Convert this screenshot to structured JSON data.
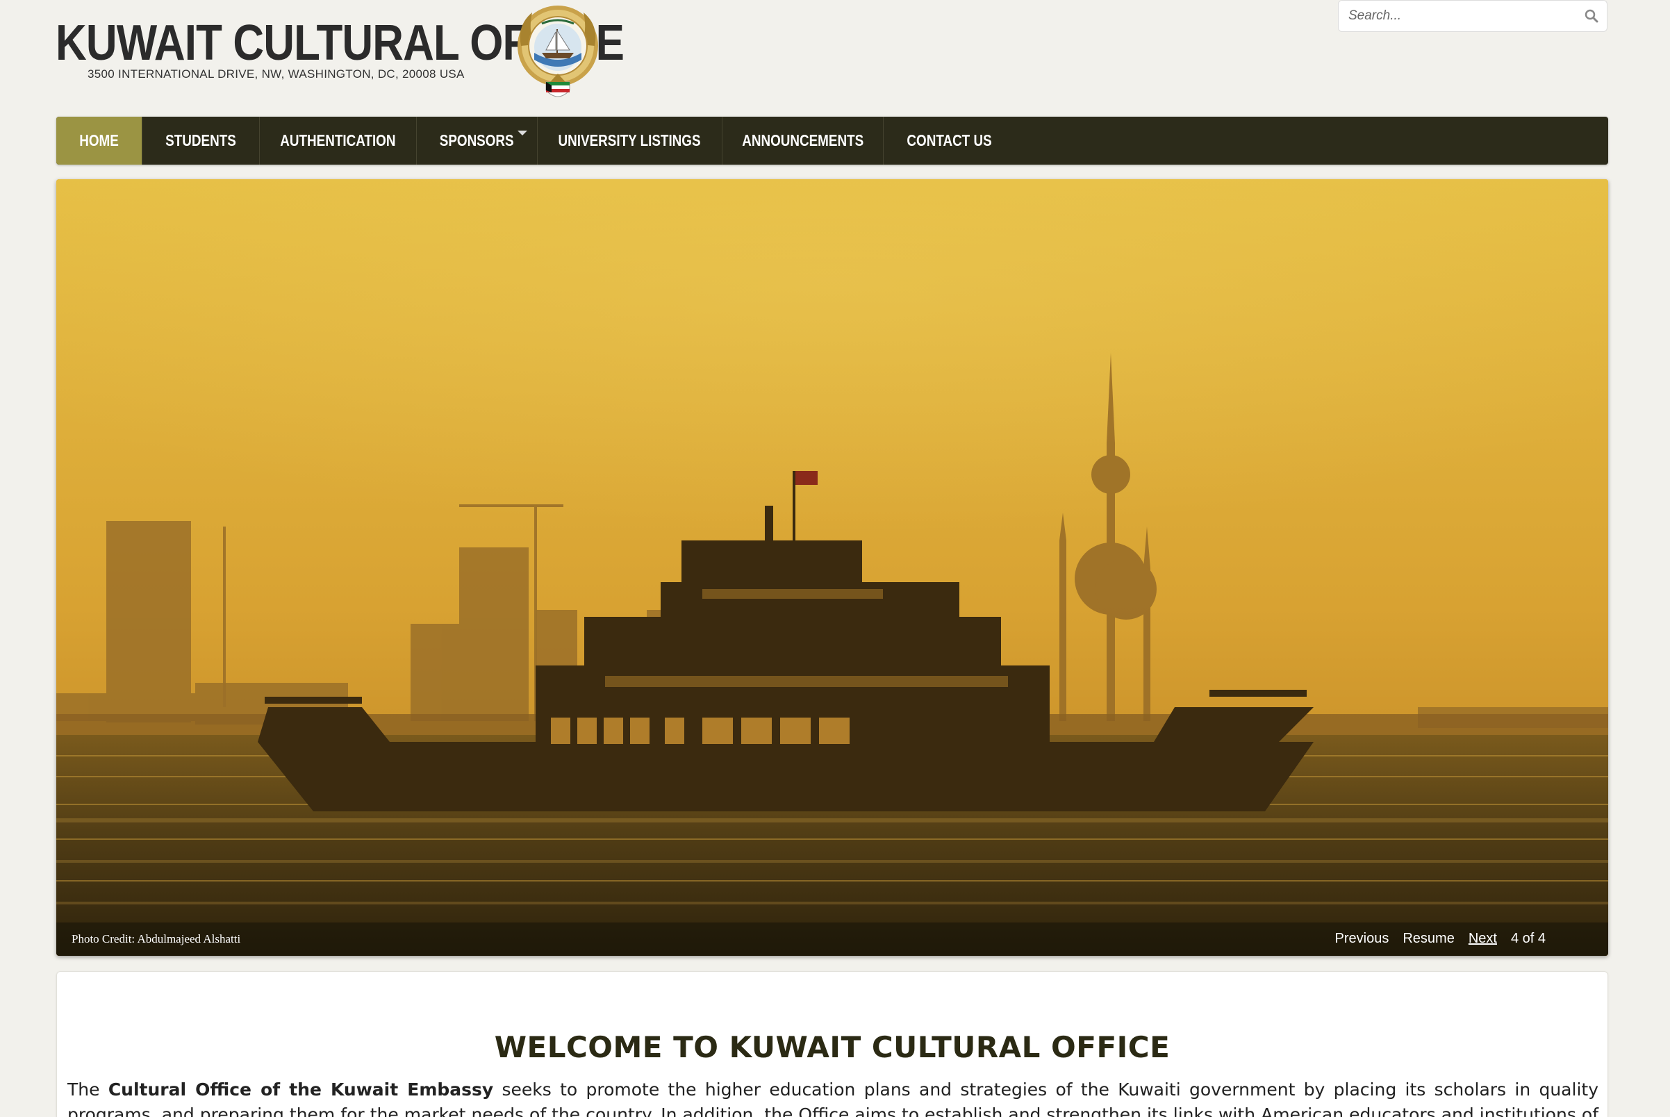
{
  "header": {
    "title": "KUWAIT CULTURAL OFFICE",
    "address": "3500 INTERNATIONAL DRIVE, NW, WASHINGTON, DC, 20008 USA",
    "emblem_icon": "kuwait-emblem-icon"
  },
  "search": {
    "placeholder": "Search...",
    "icon": "search-icon"
  },
  "nav": {
    "items": [
      {
        "label": "HOME",
        "active": true
      },
      {
        "label": "STUDENTS"
      },
      {
        "label": "AUTHENTICATION"
      },
      {
        "label": "SPONSORS",
        "has_dropdown": true
      },
      {
        "label": "UNIVERSITY LISTINGS"
      },
      {
        "label": "ANNOUNCEMENTS"
      },
      {
        "label": "CONTACT US"
      }
    ]
  },
  "slideshow": {
    "photo_credit": "Photo Credit: Abdulmajeed Alshatti",
    "previous_label": "Previous",
    "resume_label": "Resume",
    "next_label": "Next",
    "counter": "4 of 4"
  },
  "content": {
    "welcome_title": "WELCOME TO KUWAIT CULTURAL OFFICE",
    "intro_prefix": "The ",
    "intro_bold": "Cultural Office of the Kuwait Embassy",
    "intro_rest": " seeks to promote the higher education plans and strategies of the Kuwaiti government by placing its scholars in quality programs, and preparing them for the market needs of the country. In addition, the Office aims to establish and strengthen its links with American educators and institutions of higher learning for"
  },
  "colors": {
    "nav_bg": "#2c2b1a",
    "nav_active": "#9b9443",
    "page_bg": "#f2f1ec",
    "title_dark": "#2b2a14"
  }
}
